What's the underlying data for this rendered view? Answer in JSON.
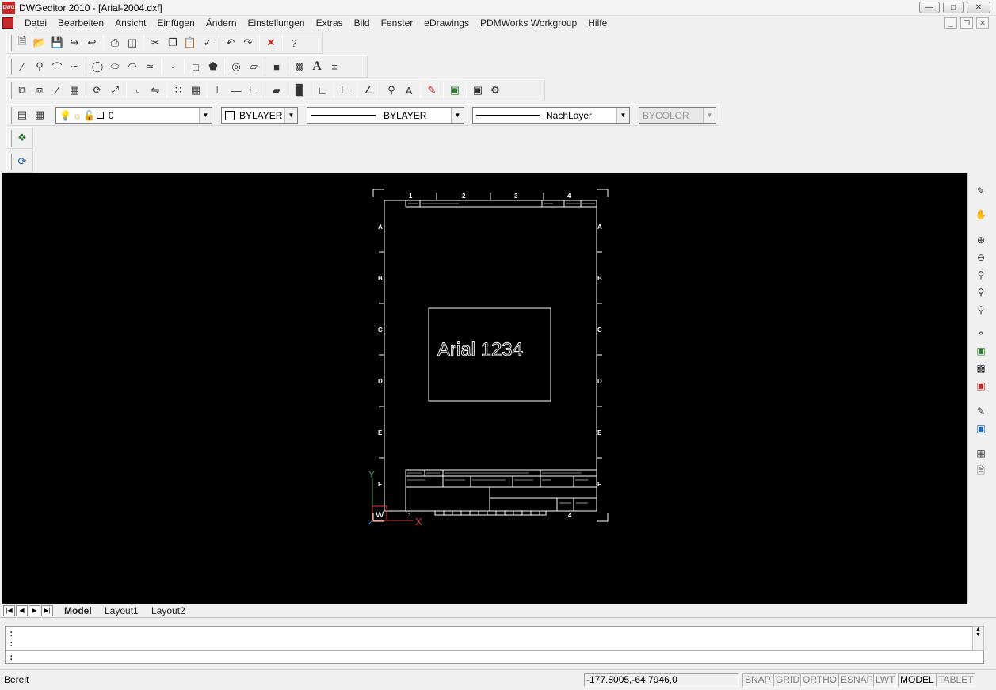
{
  "window": {
    "title": "DWGeditor 2010 - [Arial-2004.dxf]",
    "app_icon_label": "DWG"
  },
  "menu": {
    "items": [
      "Datei",
      "Bearbeiten",
      "Ansicht",
      "Einfügen",
      "Ändern",
      "Einstellungen",
      "Extras",
      "Bild",
      "Fenster",
      "eDrawings",
      "PDMWorks Workgroup",
      "Hilfe"
    ]
  },
  "properties_bar": {
    "layer_value": "0",
    "color_value": "BYLAYER",
    "linetype_value": "BYLAYER",
    "lineweight_value": "NachLayer",
    "plotstyle_value": "BYCOLOR"
  },
  "drawing": {
    "text": "Arial 1234",
    "col_labels": [
      "1",
      "2",
      "3",
      "4"
    ],
    "row_labels": [
      "A",
      "B",
      "C",
      "D",
      "E",
      "F"
    ],
    "ucs_x": "X",
    "ucs_y": "Y",
    "ucs_w": "W",
    "bottom_labels": [
      "1",
      "4"
    ]
  },
  "layout_tabs": {
    "tabs": [
      "Model",
      "Layout1",
      "Layout2"
    ],
    "active": "Model"
  },
  "command": {
    "lines": [
      ":",
      ":",
      ":"
    ]
  },
  "status": {
    "text": "Bereit",
    "coords": "-177.8005,-64.7946,0",
    "buttons": [
      "SNAP",
      "GRID",
      "ORTHO",
      "ESNAP",
      "LWT",
      "MODEL",
      "TABLET"
    ],
    "active_button": "MODEL"
  },
  "colors": {
    "canvas": "#000000",
    "ucs_x": "#e53935",
    "ucs_y": "#43a047",
    "accent_icon": "#c62828"
  }
}
